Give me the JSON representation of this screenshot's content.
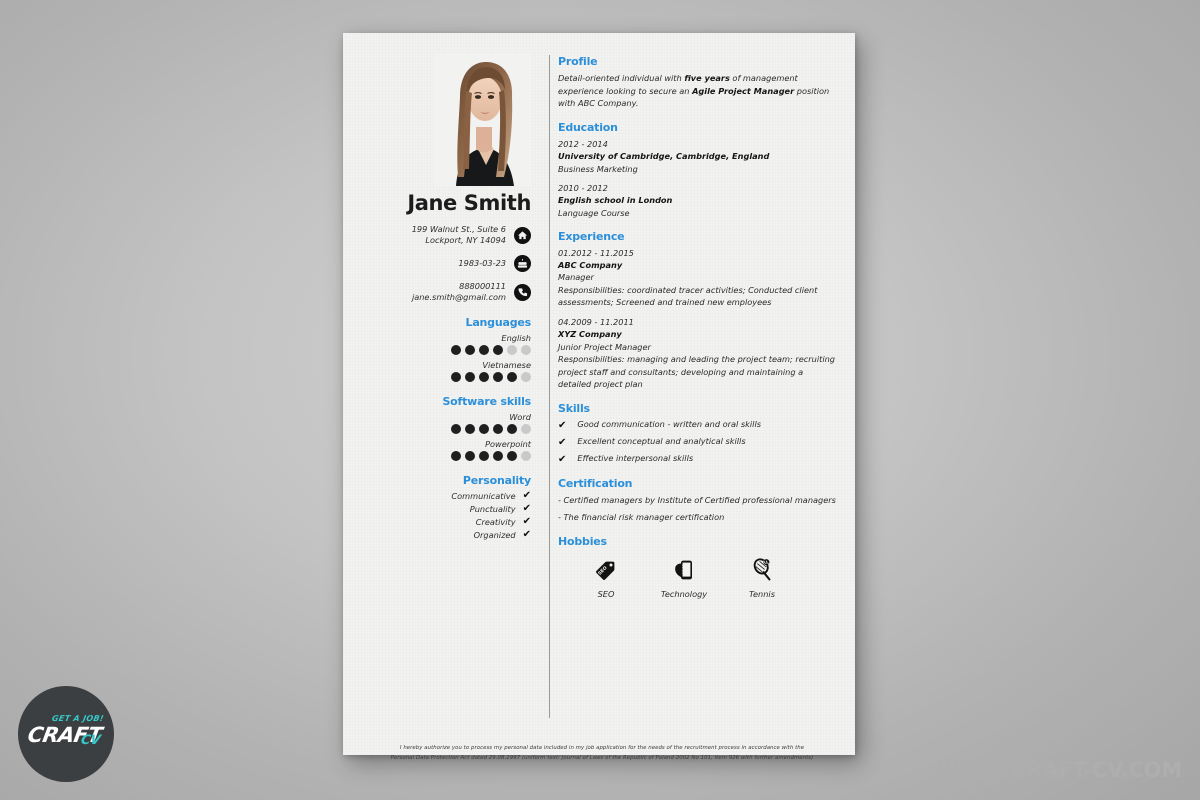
{
  "theme": {
    "accent_blue": "#2B8FD9",
    "page_bg": "#F2F2F1",
    "canvas_bg": "#BFBFBF",
    "ink": "#2B2B2B",
    "dot_on": "#1F1F1F",
    "dot_off": "#C9C9C9",
    "logo_teal": "#35C8C8",
    "logo_circle": "#3C3F41"
  },
  "person": {
    "name": "Jane Smith",
    "photo_alt": "portrait-photo",
    "contacts": [
      {
        "icon": "home-icon",
        "lines": [
          "199 Walnut St., Suite 6",
          "Lockport, NY 14094"
        ]
      },
      {
        "icon": "birthday-cake-icon",
        "lines": [
          "1983-03-23"
        ]
      },
      {
        "icon": "phone-icon",
        "lines": [
          "888000111",
          "jane.smith@gmail.com"
        ]
      }
    ]
  },
  "languages": {
    "heading": "Languages",
    "items": [
      {
        "label": "English",
        "filled": 4,
        "total": 6
      },
      {
        "label": "Vietnamese",
        "filled": 5,
        "total": 6
      }
    ]
  },
  "software_skills": {
    "heading": "Software skills",
    "items": [
      {
        "label": "Word",
        "filled": 5,
        "total": 6
      },
      {
        "label": "Powerpoint",
        "filled": 5,
        "total": 6
      }
    ]
  },
  "personality": {
    "heading": "Personality",
    "check_glyph": "✔",
    "items": [
      {
        "label": "Communicative"
      },
      {
        "label": "Punctuality"
      },
      {
        "label": "Creativity"
      },
      {
        "label": "Organized"
      }
    ]
  },
  "profile": {
    "heading": "Profile",
    "text_parts": [
      {
        "text": "Detail-oriented individual with ",
        "bold": false
      },
      {
        "text": "five years",
        "bold": true
      },
      {
        "text": " of management experience looking to secure an ",
        "bold": false
      },
      {
        "text": "Agile Project Manager",
        "bold": true
      },
      {
        "text": " position with ABC Company.",
        "bold": false
      }
    ]
  },
  "education": {
    "heading": "Education",
    "entries": [
      {
        "date": "2012 - 2014",
        "org": "University of Cambridge, Cambridge, England",
        "sub": "Business Marketing"
      },
      {
        "date": "2010 - 2012",
        "org": "English school in London",
        "sub": "Language Course"
      }
    ]
  },
  "experience": {
    "heading": "Experience",
    "entries": [
      {
        "date": "01.2012 - 11.2015",
        "org": "ABC Company",
        "sub": "Manager",
        "desc": "Responsibilities: coordinated tracer activities;  Conducted client assessments; Screened and trained new employees"
      },
      {
        "date": "04.2009 - 11.2011",
        "org": "XYZ Company",
        "sub": "Junior Project Manager",
        "desc": "Responsibilities: managing and leading the project team; recruiting project staff and consultants; developing and maintaining a detailed project plan"
      }
    ]
  },
  "skills": {
    "heading": "Skills",
    "check_glyph": "✔",
    "items": [
      "Good communication - written and oral skills",
      "Excellent conceptual and analytical skills",
      "Effective interpersonal skills"
    ]
  },
  "certification": {
    "heading": "Certification",
    "items": [
      "- Certified managers by Institute of Certified professional managers",
      "- The financial risk manager certification"
    ]
  },
  "hobbies": {
    "heading": "Hobbies",
    "items": [
      {
        "label": "SEO",
        "icon": "seo-tag-icon"
      },
      {
        "label": "Technology",
        "icon": "hand-holding-phone-icon"
      },
      {
        "label": "Tennis",
        "icon": "tennis-racket-icon"
      }
    ]
  },
  "footer": {
    "line1": "I hereby authorize you to process my personal data included in my job application for the needs of the recruitment process in accordance with the",
    "line2": "Personal Data Protection Act dated 29.08.1997 (uniform text: Journal of Laws of the Republic of Poland 2002 No 101, item 926 with further amendments)"
  },
  "brand": {
    "tagline": "GET A JOB!",
    "name": "CRAFT",
    "suffix": "CV",
    "watermark": "WWW.CRAFT-CV.COM"
  }
}
